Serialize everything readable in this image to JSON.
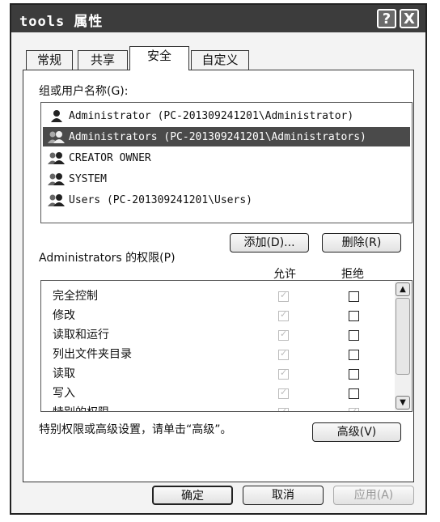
{
  "window": {
    "title": "tools 属性",
    "help_button": "?",
    "close_button": "X"
  },
  "tabs": [
    {
      "label": "常规"
    },
    {
      "label": "共享"
    },
    {
      "label": "安全"
    },
    {
      "label": "自定义"
    }
  ],
  "users_section": {
    "label": "组或用户名称(G):",
    "items": [
      {
        "label": "Administrator (PC-201309241201\\Administrator)"
      },
      {
        "label": "Administrators (PC-201309241201\\Administrators)"
      },
      {
        "label": "CREATOR OWNER"
      },
      {
        "label": "SYSTEM"
      },
      {
        "label": "Users (PC-201309241201\\Users)"
      }
    ],
    "selected_index": 1,
    "add_button": "添加(D)...",
    "remove_button": "删除(R)"
  },
  "permissions": {
    "label": "Administrators 的权限(P)",
    "allow_header": "允许",
    "deny_header": "拒绝",
    "rows": [
      {
        "name": "完全控制"
      },
      {
        "name": "修改"
      },
      {
        "name": "读取和运行"
      },
      {
        "name": "列出文件夹目录"
      },
      {
        "name": "读取"
      },
      {
        "name": "写入"
      },
      {
        "name": "特别的权限"
      }
    ]
  },
  "advanced": {
    "text": "特别权限或高级设置，请单击“高级”。",
    "button": "高级(V)"
  },
  "footer": {
    "ok": "确定",
    "cancel": "取消",
    "apply": "应用(A)"
  }
}
